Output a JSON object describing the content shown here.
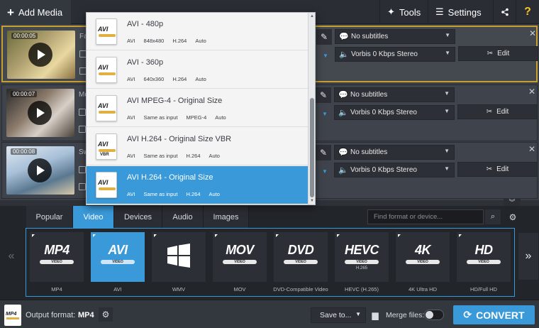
{
  "toolbar": {
    "add_media": "Add Media",
    "tools": "Tools",
    "settings": "Settings",
    "help": "?"
  },
  "files": [
    {
      "duration": "00:00:05",
      "name": "Far",
      "subtitles": "No subtitles",
      "audio": "Vorbis 0 Kbps Stereo",
      "edit": "Edit"
    },
    {
      "duration": "00:00:07",
      "name": "Mo",
      "subtitles": "No subtitles",
      "audio": "Vorbis 0 Kbps Stereo",
      "edit": "Edit"
    },
    {
      "duration": "00:00:08",
      "name": "Sw",
      "subtitles": "No subtitles",
      "audio": "Vorbis 0 Kbps Stereo",
      "edit": "Edit"
    }
  ],
  "preset_dropdown": {
    "icon_label": "AVI",
    "items": [
      {
        "title": "AVI - 480p",
        "meta": [
          "AVI",
          "848x480",
          "H.264",
          "Auto"
        ],
        "badge": ""
      },
      {
        "title": "AVI - 360p",
        "meta": [
          "AVI",
          "640x360",
          "H.264",
          "Auto"
        ],
        "badge": ""
      },
      {
        "title": "AVI MPEG-4 - Original Size",
        "meta": [
          "AVI",
          "Same as input",
          "MPEG-4",
          "Auto"
        ],
        "badge": ""
      },
      {
        "title": "AVI H.264 - Original Size VBR",
        "meta": [
          "AVI",
          "Same as input",
          "H.264",
          "Auto"
        ],
        "badge": "VBR"
      },
      {
        "title": "AVI H.264 - Original Size",
        "meta": [
          "AVI",
          "Same as input",
          "H.264",
          "Auto"
        ],
        "badge": ""
      }
    ],
    "selected_index": 4
  },
  "format_panel": {
    "tabs": [
      "Popular",
      "Video",
      "Devices",
      "Audio",
      "Images"
    ],
    "active_tab": "Video",
    "search_placeholder": "Find format or device...",
    "formats": [
      {
        "tile": "MP4",
        "band": "VIDEO",
        "label": "MP4"
      },
      {
        "tile": "AVI",
        "band": "VIDEO",
        "label": "AVI"
      },
      {
        "tile": "",
        "band": "",
        "label": "WMV"
      },
      {
        "tile": "MOV",
        "band": "VIDEO",
        "label": "MOV"
      },
      {
        "tile": "DVD",
        "band": "VIDEO",
        "label": "DVD-Compatible Video"
      },
      {
        "tile": "HEVC",
        "band": "VIDEO",
        "sub": "H.265",
        "label": "HEVC (H.265)"
      },
      {
        "tile": "4K",
        "band": "VIDEO",
        "label": "4K Ultra HD"
      },
      {
        "tile": "HD",
        "band": "VIDEO",
        "label": "HD/Full HD"
      }
    ],
    "active_format": "AVI"
  },
  "bottom": {
    "output_label": "Output format:",
    "output_value": "MP4",
    "icon_label": "MP4",
    "save_to": "Save to...",
    "merge_files": "Merge files:",
    "convert": "CONVERT"
  },
  "colors": {
    "accent": "#3a9ad9",
    "selected_border": "#c8a030",
    "background": "#2e3238"
  }
}
